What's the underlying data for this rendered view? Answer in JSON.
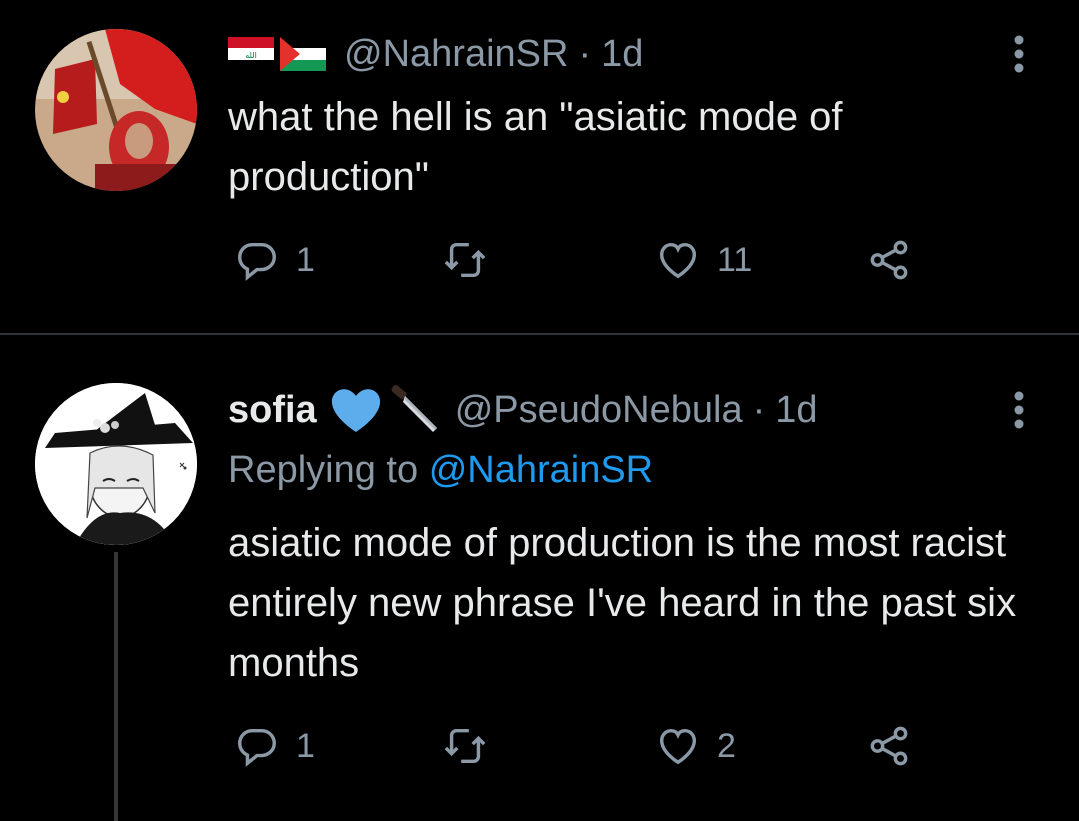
{
  "tweets": [
    {
      "handle": "@NahrainSR",
      "separator": "·",
      "time": "1d",
      "text": "what the hell is an \"asiatic mode of production\"",
      "actions": {
        "reply_count": "1",
        "retweet_count": "",
        "like_count": "11"
      },
      "flags": [
        "iraq-flag-icon",
        "palestine-flag-icon"
      ]
    },
    {
      "name": "sofia",
      "handle": "@PseudoNebula",
      "separator": "·",
      "time": "1d",
      "replying_prefix": "Replying to",
      "replying_to": "@NahrainSR",
      "text": "asiatic mode of production is the most racist entirely new phrase I've heard in the past six months",
      "actions": {
        "reply_count": "1",
        "retweet_count": "",
        "like_count": "2"
      },
      "emojis": [
        "blue-heart-icon",
        "knife-icon"
      ]
    }
  ],
  "colors": {
    "background": "#000000",
    "text": "#e7e9ea",
    "muted": "#8b98a5",
    "link": "#1d9bf0",
    "divider": "#2f3336"
  }
}
